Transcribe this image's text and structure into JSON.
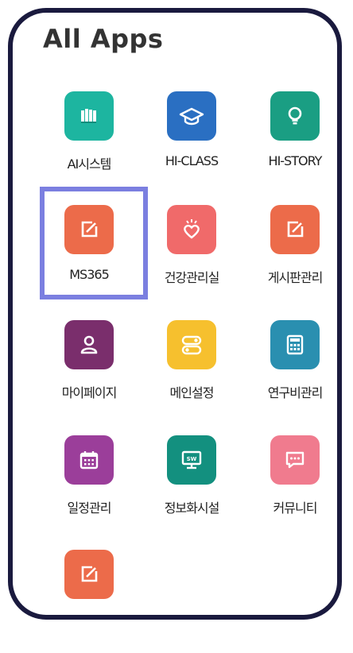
{
  "header": {
    "title": "All Apps"
  },
  "apps": [
    {
      "label": "AI시스템",
      "icon": "books-icon",
      "color": "#1db5a0"
    },
    {
      "label": "HI-CLASS",
      "icon": "graduation-cap-icon",
      "color": "#2a6fc2"
    },
    {
      "label": "HI-STORY",
      "icon": "lightbulb-icon",
      "color": "#1a9e83"
    },
    {
      "label": "MS365",
      "icon": "edit-icon",
      "color": "#ec6b4a"
    },
    {
      "label": "건강관리실",
      "icon": "heart-icon",
      "color": "#f06a6a"
    },
    {
      "label": "게시판관리",
      "icon": "edit-icon",
      "color": "#ec6b4a"
    },
    {
      "label": "마이페이지",
      "icon": "user-icon",
      "color": "#7a2e6c"
    },
    {
      "label": "메인설정",
      "icon": "toggle-icon",
      "color": "#f6c02e"
    },
    {
      "label": "연구비관리",
      "icon": "calculator-icon",
      "color": "#2a8fb0"
    },
    {
      "label": "일정관리",
      "icon": "calendar-icon",
      "color": "#9b3e9a"
    },
    {
      "label": "정보화시설",
      "icon": "monitor-sw-icon",
      "color": "#13907f"
    },
    {
      "label": "커뮤니티",
      "icon": "chat-icon",
      "color": "#f07b8e"
    },
    {
      "label": "",
      "icon": "edit-icon",
      "color": "#ec6b4a"
    }
  ],
  "selection": {
    "highlighted_app": "MS365",
    "highlight_color": "#7b7fe0"
  }
}
